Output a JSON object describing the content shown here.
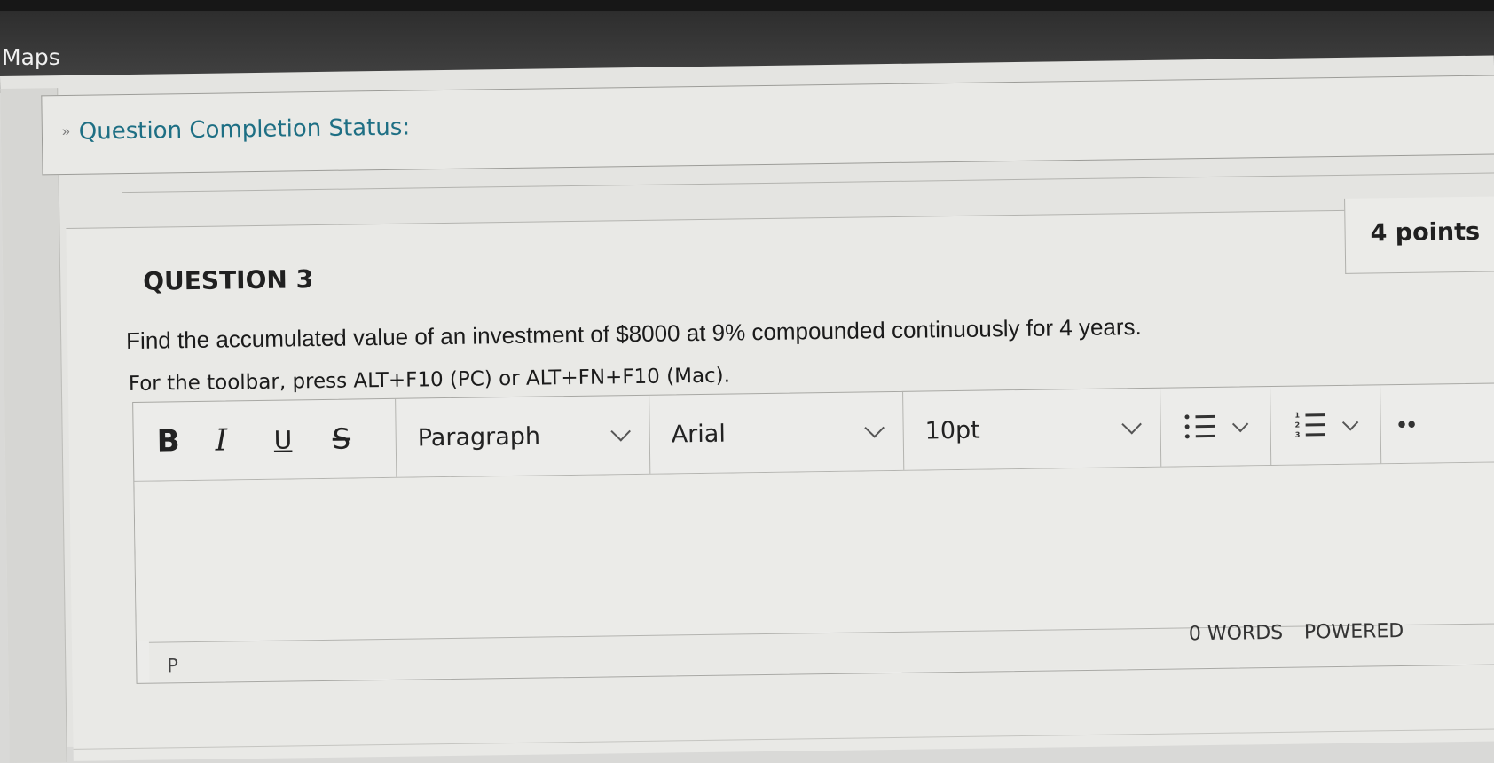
{
  "browser": {
    "bookmark_label": "Maps"
  },
  "completion_status": {
    "toggle_icon": "double-chevron-down-icon",
    "label": "Question Completion Status:"
  },
  "question": {
    "title": "QUESTION 3",
    "points": "4 points",
    "prompt": "Find the accumulated value of an investment of $8000 at 9% compounded continuously for 4 years.",
    "toolbar_hint": "For the toolbar, press ALT+F10 (PC) or ALT+FN+F10 (Mac)."
  },
  "editor": {
    "toolbar": {
      "bold_label": "B",
      "italic_label": "I",
      "underline_label": "U",
      "strike_label": "S",
      "block_format": "Paragraph",
      "font_family": "Arial",
      "font_size": "10pt",
      "bullet_list_icon": "bullet-list-icon",
      "numbered_list_icon": "numbered-list-icon",
      "more_icon": "more-icon"
    },
    "content": "",
    "status": {
      "path": "P",
      "word_count": "0 WORDS",
      "powered_by": "POWERED"
    }
  },
  "colors": {
    "status_link": "#1e6f84",
    "top_bar": "#3a3a3a"
  }
}
